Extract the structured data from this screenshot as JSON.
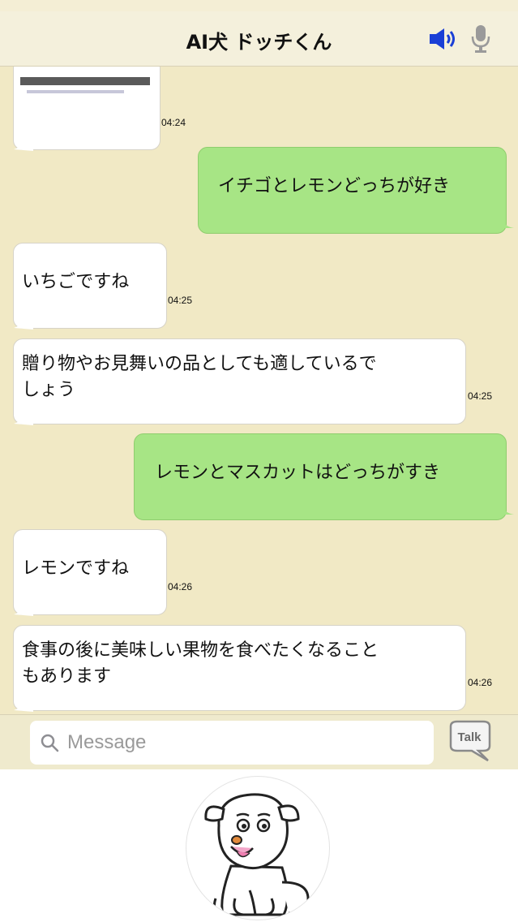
{
  "header": {
    "title": "AI犬 ドッチくん"
  },
  "messages": [
    {
      "side": "left",
      "type": "image",
      "time": "04:24"
    },
    {
      "side": "right",
      "text": "イチゴとレモンどっちが好き"
    },
    {
      "side": "left",
      "text": "いちごですね",
      "time": "04:25"
    },
    {
      "side": "left",
      "text_lines": [
        "贈り物やお見舞いの品としても適しているで",
        "しょう"
      ],
      "time": "04:25"
    },
    {
      "side": "right",
      "text": "レモンとマスカットはどっちがすき"
    },
    {
      "side": "left",
      "text": "レモンですね",
      "time": "04:26"
    },
    {
      "side": "left",
      "text_lines": [
        "食事の後に美味しい果物を食べたくなること",
        "もあります"
      ],
      "time": "04:26"
    }
  ],
  "input": {
    "placeholder": "Message"
  },
  "talk_button": {
    "label": "Talk"
  },
  "icons": {
    "speaker": "speaker-icon",
    "mic": "mic-icon",
    "search": "search-icon",
    "talk": "talk-bubble-icon",
    "avatar": "dog-avatar"
  },
  "colors": {
    "sent_bubble": "#a7e585",
    "received_bubble": "#ffffff",
    "background": "#f1e9c5",
    "speaker_blue": "#1a3fd6"
  }
}
